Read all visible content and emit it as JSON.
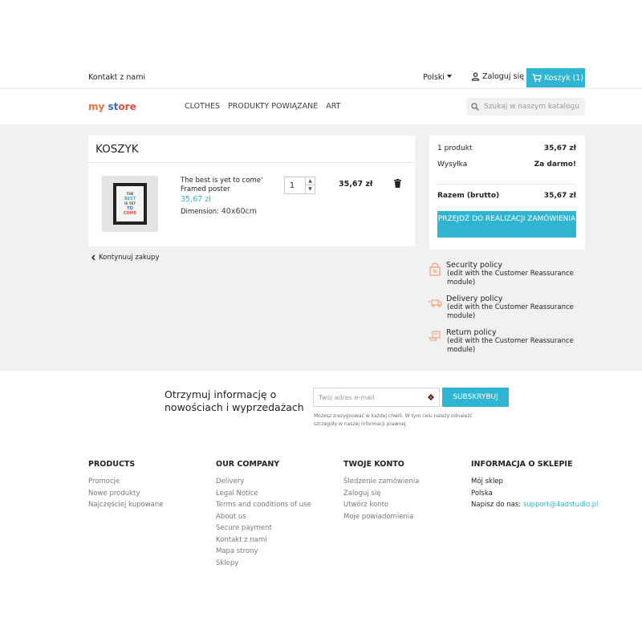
{
  "topbar": {
    "contact": "Kontakt z nami",
    "language": "Polski",
    "login": "Zaloguj się",
    "cart": "Koszyk (1)"
  },
  "header": {
    "logo": {
      "my": "my",
      "s1": "st",
      "s2": "ore"
    },
    "nav": [
      "CLOTHES",
      "PRODUKTY POWIĄZANE",
      "ART"
    ],
    "search_placeholder": "Szukaj w naszym katalogu"
  },
  "cart": {
    "title": "KOSZYK",
    "item": {
      "name": "The best is yet to come' Framed poster",
      "price": "35,67 zł",
      "dimension_label": "Dimension:",
      "dimension_value": "40x60cm",
      "quantity": "1",
      "total": "35,67 zł",
      "poster_lines": [
        "THE",
        "BEST",
        "IS YET",
        "TO",
        "COME"
      ]
    },
    "continue": "Kontynuuj zakupy"
  },
  "summary": {
    "products_label": "1 produkt",
    "products_value": "35,67 zł",
    "shipping_label": "Wysyłka",
    "shipping_value": "Za darmo!",
    "total_label": "Razem (brutto)",
    "total_value": "35,67 zł",
    "checkout": "PRZEJDŹ DO REALIZACJI ZAMÓWIENIA"
  },
  "reassurance": [
    {
      "title": "Security policy",
      "sub": "(edit with the Customer Reassurance module)",
      "icon": "lock-icon"
    },
    {
      "title": "Delivery policy",
      "sub": "(edit with the Customer Reassurance module)",
      "icon": "truck-icon"
    },
    {
      "title": "Return policy",
      "sub": "(edit with the Customer Reassurance module)",
      "icon": "return-icon"
    }
  ],
  "newsletter": {
    "title": "Otrzymuj informację o nowościach i wyprzedażach",
    "placeholder": "Twój adres e-mail",
    "button": "SUBSKRYBUJ",
    "note": "Możesz zrezygnować w każdej chwili. W tym celu należy odnaleźć szczegóły w naszej informacji prawnej."
  },
  "footer": {
    "products": {
      "title": "PRODUCTS",
      "items": [
        "Promocje",
        "Nowe produkty",
        "Najczęściej kupowane"
      ]
    },
    "company": {
      "title": "OUR COMPANY",
      "items": [
        "Delivery",
        "Legal Notice",
        "Terms and conditions of use",
        "About us",
        "Secure payment",
        "Kontakt z nami",
        "Mapa strony",
        "Sklepy"
      ]
    },
    "account": {
      "title": "TWOJE KONTO",
      "items": [
        "Śledzenie zamówienia",
        "Zaloguj się",
        "Utwórz konto",
        "Moje powiadomienia"
      ]
    },
    "store": {
      "title": "INFORMACJA O SKLEPIE",
      "lines": [
        "Mój sklep",
        "Polska"
      ],
      "email_label": "Napisz do nas:",
      "email": "support@4adstudio.pl"
    }
  },
  "colors": {
    "accent": "#2fb5d2",
    "background": "#f1f1f1"
  }
}
